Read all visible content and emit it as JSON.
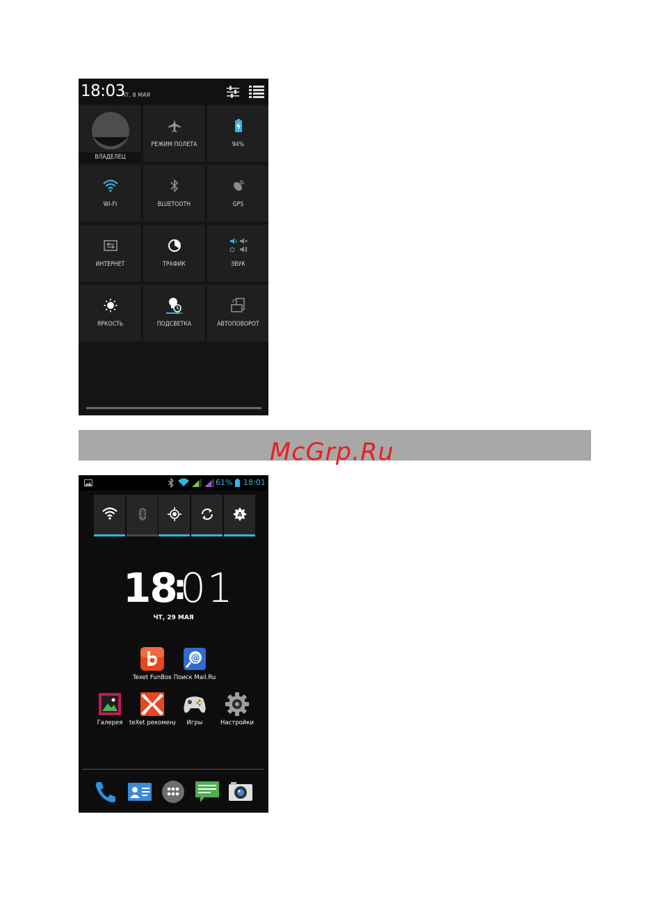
{
  "quick_settings": {
    "time": "18:03",
    "date": "ЧТ, 8 МАЯ",
    "tiles": [
      {
        "label": "ВЛАДЕЛЕЦ",
        "icon": "owner-avatar-icon"
      },
      {
        "label": "РЕЖИМ ПОЛЕТА",
        "icon": "airplane-icon"
      },
      {
        "label": "94%",
        "icon": "battery-charging-icon"
      },
      {
        "label": "WI-FI",
        "icon": "wifi-icon"
      },
      {
        "label": "BLUETOOTH",
        "icon": "bluetooth-icon"
      },
      {
        "label": "GPS",
        "icon": "gps-icon"
      },
      {
        "label": "ИНТЕРНЕТ",
        "icon": "mobile-data-icon"
      },
      {
        "label": "ТРАФИК",
        "icon": "data-usage-icon"
      },
      {
        "label": "ЗВУК",
        "icon": "sound-profile-icon"
      },
      {
        "label": "ЯРКОСТЬ",
        "icon": "brightness-icon"
      },
      {
        "label": "ПОДСВЕТКА",
        "icon": "screen-timeout-icon"
      },
      {
        "label": "АВТОПОВОРОТ",
        "icon": "auto-rotate-icon"
      }
    ]
  },
  "watermark": "McGrp.Ru",
  "home": {
    "status_bar": {
      "battery_percent": "61%",
      "time": "18:01"
    },
    "widget_toggles": [
      {
        "icon": "wifi-icon",
        "active": true
      },
      {
        "icon": "bluetooth-icon",
        "active": false
      },
      {
        "icon": "gps-icon",
        "active": true
      },
      {
        "icon": "sync-icon",
        "active": true
      },
      {
        "icon": "brightness-icon",
        "active": true
      }
    ],
    "clock": {
      "hours": "18",
      "separator": ":",
      "minutes": "01",
      "date": "ЧТ, 29 МАЯ"
    },
    "apps_row1": [
      {
        "label": "Texet FunBox",
        "icon": "funbox-icon"
      },
      {
        "label": "Поиск Mail.Ru",
        "icon": "mailru-search-icon"
      }
    ],
    "apps_row2": [
      {
        "label": "Галерея",
        "icon": "gallery-icon"
      },
      {
        "label": "teXet рекомендует",
        "icon": "texet-icon"
      },
      {
        "label": "Игры",
        "icon": "games-icon"
      },
      {
        "label": "Настройки",
        "icon": "settings-icon"
      }
    ],
    "dock": [
      {
        "icon": "phone-icon"
      },
      {
        "icon": "contacts-icon"
      },
      {
        "icon": "app-drawer-icon"
      },
      {
        "icon": "messages-icon"
      },
      {
        "icon": "camera-icon"
      }
    ],
    "colors": {
      "accent": "#33b5e5"
    }
  }
}
